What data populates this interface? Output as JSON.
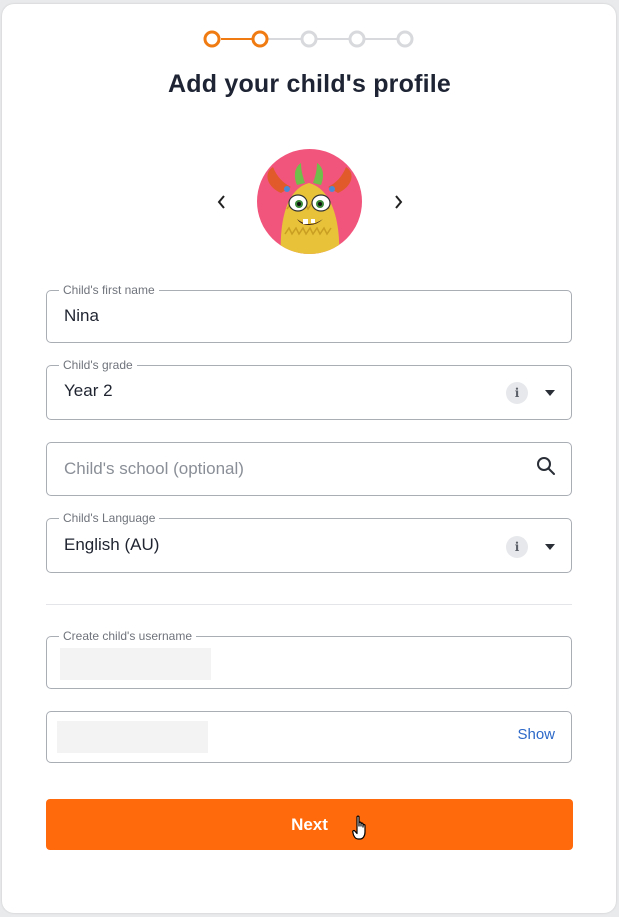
{
  "stepper": {
    "total_steps": 5,
    "current_step": 2,
    "active_color": "#f07b12",
    "inactive_color": "#d7d9dc"
  },
  "page_title": "Add your child's profile",
  "avatar": {
    "icon": "monster-avatar-icon",
    "background": "#f2557c"
  },
  "form": {
    "first_name": {
      "label": "Child's first name",
      "value": "Nina"
    },
    "grade": {
      "label": "Child's grade",
      "value": "Year 2",
      "info_icon": "i"
    },
    "school": {
      "placeholder": "Child's school (optional)"
    },
    "language": {
      "label": "Child's Language",
      "value": "English (AU)",
      "info_icon": "i"
    },
    "username": {
      "label": "Create child's username"
    },
    "password": {
      "show_label": "Show"
    }
  },
  "next_button": {
    "label": "Next",
    "color": "#ff6a0d"
  }
}
